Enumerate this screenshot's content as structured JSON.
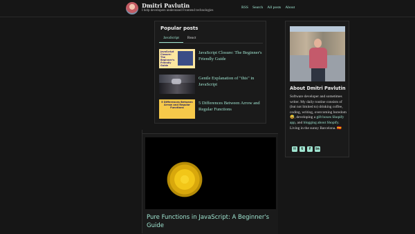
{
  "header": {
    "site_title": "Dmitri Pavlutin",
    "tagline": "I help developers understand Frontend technologies",
    "nav": [
      "RSS",
      "Search",
      "All posts",
      "About"
    ]
  },
  "popular": {
    "title": "Popular posts",
    "tabs": [
      "JavaScript",
      "React"
    ],
    "active_tab": "JavaScript",
    "items": [
      {
        "title": "JavaScript Closure: The Beginner's Friendly Guide",
        "thumb_text": "JavaScript Closure: The Beginner's Friendly Guide"
      },
      {
        "title": "Gentle Explanation of \"this\" in JavaScript"
      },
      {
        "title": "5 Differences Between Arrow and Regular Functions",
        "thumb_text": "5 Differences Between Arrow and Regular Functions"
      }
    ]
  },
  "article": {
    "title": "Pure Functions in JavaScript: A Beginner's Guide"
  },
  "about": {
    "title": "About Dmitri Pavlutin",
    "bio_1": "Software developer and sometimes writer. My daily routine consists of (but not limited to) drinking coffee, coding, writing, overcoming boredom 😅, developing a ",
    "bio_link_1": "gift boxes Shopify app",
    "bio_2": ", and ",
    "bio_link_2": "blogging about Shopify",
    "bio_3": ". Living in the sunny Barcelona. 🇪🇸",
    "socials": [
      "email-icon",
      "twitter-icon",
      "facebook-icon",
      "linkedin-icon"
    ]
  },
  "colors": {
    "accent": "#9fe4d0",
    "background": "#161616",
    "card": "#1a1a1a"
  }
}
